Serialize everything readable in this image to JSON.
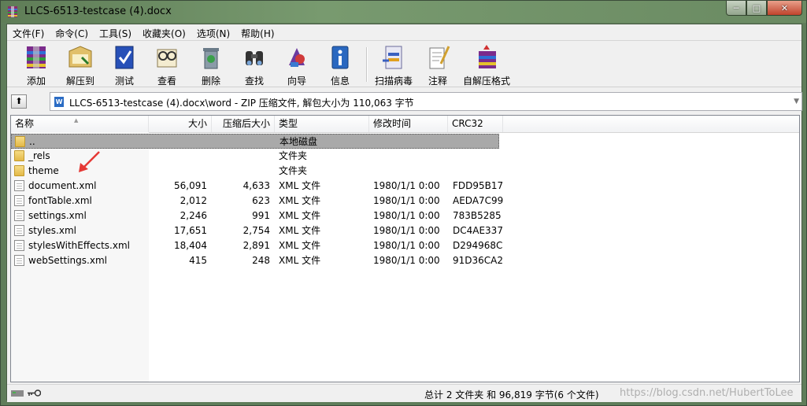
{
  "window": {
    "title": "LLCS-6513-testcase (4).docx"
  },
  "menu": [
    "文件(F)",
    "命令(C)",
    "工具(S)",
    "收藏夹(O)",
    "选项(N)",
    "帮助(H)"
  ],
  "toolbar": [
    {
      "label": "添加",
      "icon": "add-archive-icon"
    },
    {
      "label": "解压到",
      "icon": "extract-to-icon"
    },
    {
      "label": "测试",
      "icon": "test-icon"
    },
    {
      "label": "查看",
      "icon": "view-icon"
    },
    {
      "label": "删除",
      "icon": "delete-icon"
    },
    {
      "label": "查找",
      "icon": "find-icon"
    },
    {
      "label": "向导",
      "icon": "wizard-icon"
    },
    {
      "label": "信息",
      "icon": "info-icon"
    },
    {
      "label": "扫描病毒",
      "icon": "virus-scan-icon"
    },
    {
      "label": "注释",
      "icon": "comment-icon"
    },
    {
      "label": "自解压格式",
      "icon": "sfx-icon"
    }
  ],
  "address": {
    "text": "LLCS-6513-testcase (4).docx\\word - ZIP 压缩文件, 解包大小为 110,063 字节"
  },
  "columns": [
    "名称",
    "大小",
    "压缩后大小",
    "类型",
    "修改时间",
    "CRC32"
  ],
  "rows": [
    {
      "name": "..",
      "size": "",
      "packed": "",
      "type": "本地磁盘",
      "modified": "",
      "crc": "",
      "kind": "folder"
    },
    {
      "name": "_rels",
      "size": "",
      "packed": "",
      "type": "文件夹",
      "modified": "",
      "crc": "",
      "kind": "folder"
    },
    {
      "name": "theme",
      "size": "",
      "packed": "",
      "type": "文件夹",
      "modified": "",
      "crc": "",
      "kind": "folder"
    },
    {
      "name": "document.xml",
      "size": "56,091",
      "packed": "4,633",
      "type": "XML 文件",
      "modified": "1980/1/1 0:00",
      "crc": "FDD95B17",
      "kind": "file"
    },
    {
      "name": "fontTable.xml",
      "size": "2,012",
      "packed": "623",
      "type": "XML 文件",
      "modified": "1980/1/1 0:00",
      "crc": "AEDA7C99",
      "kind": "file"
    },
    {
      "name": "settings.xml",
      "size": "2,246",
      "packed": "991",
      "type": "XML 文件",
      "modified": "1980/1/1 0:00",
      "crc": "783B5285",
      "kind": "file"
    },
    {
      "name": "styles.xml",
      "size": "17,651",
      "packed": "2,754",
      "type": "XML 文件",
      "modified": "1980/1/1 0:00",
      "crc": "DC4AE337",
      "kind": "file"
    },
    {
      "name": "stylesWithEffects.xml",
      "size": "18,404",
      "packed": "2,891",
      "type": "XML 文件",
      "modified": "1980/1/1 0:00",
      "crc": "D294968C",
      "kind": "file"
    },
    {
      "name": "webSettings.xml",
      "size": "415",
      "packed": "248",
      "type": "XML 文件",
      "modified": "1980/1/1 0:00",
      "crc": "91D36CA2",
      "kind": "file"
    }
  ],
  "status": {
    "summary": "总计 2 文件夹 和 96,819 字节(6 个文件)"
  },
  "watermark": "https://blog.csdn.net/HubertToLee"
}
